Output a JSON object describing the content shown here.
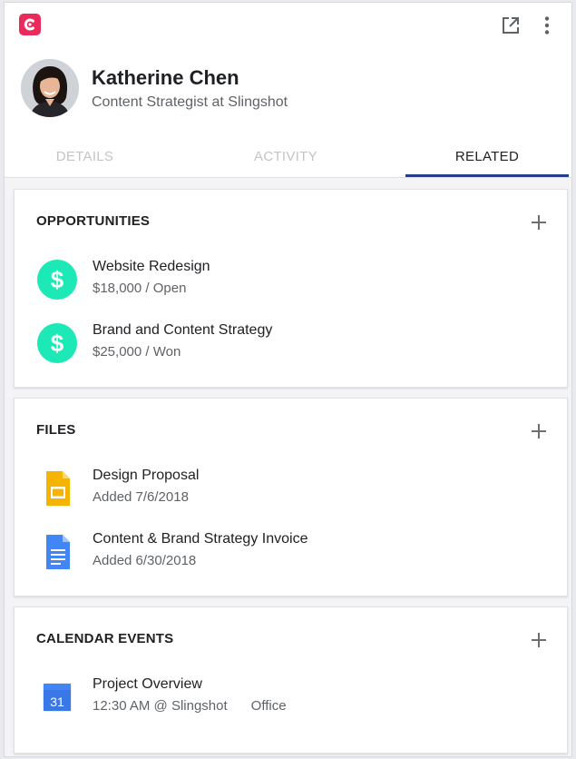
{
  "contact": {
    "name": "Katherine Chen",
    "role": "Content Strategist at Slingshot"
  },
  "tabs": [
    {
      "label": "DETAILS",
      "active": false
    },
    {
      "label": "ACTIVITY",
      "active": false
    },
    {
      "label": "RELATED",
      "active": true
    }
  ],
  "opportunities": {
    "title": "OPPORTUNITIES",
    "items": [
      {
        "name": "Website Redesign",
        "detail": "$18,000 / Open"
      },
      {
        "name": "Brand and Content Strategy",
        "detail": "$25,000 / Won"
      }
    ]
  },
  "files": {
    "title": "FILES",
    "items": [
      {
        "name": "Design Proposal",
        "detail": "Added 7/6/2018",
        "icon": "slides-file-icon"
      },
      {
        "name": "Content & Brand Strategy Invoice",
        "detail": "Added 6/30/2018",
        "icon": "docs-file-icon"
      }
    ]
  },
  "calendar": {
    "title": "CALENDAR EVENTS",
    "items": [
      {
        "name": "Project Overview",
        "time": "12:30 AM @ Slingshot",
        "location": "Office",
        "day": "31"
      }
    ]
  },
  "colors": {
    "brand": "#ea2a5a",
    "active_tab_underline": "#233d8c",
    "opportunity_icon": "#1de9b6",
    "slides_icon": "#f4b400",
    "docs_icon": "#4285f4"
  }
}
